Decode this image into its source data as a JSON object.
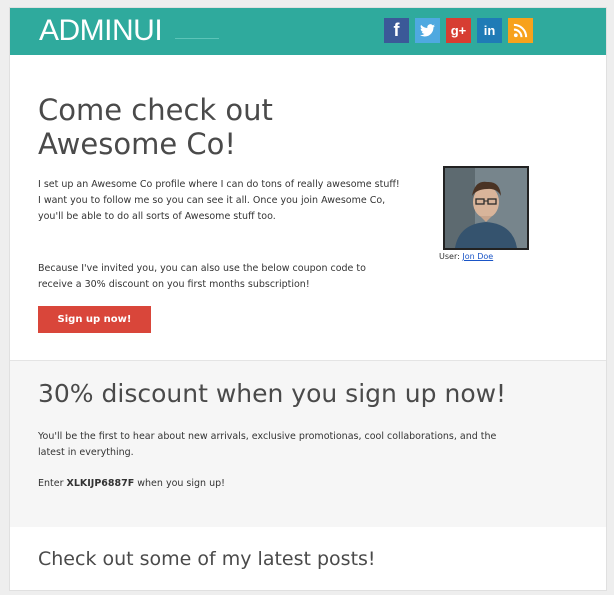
{
  "header": {
    "logo": "ADMINUI",
    "social": [
      {
        "name": "facebook-icon",
        "glyph": "f"
      },
      {
        "name": "twitter-icon",
        "glyph": "🐦"
      },
      {
        "name": "google-plus-icon",
        "glyph": "g+"
      },
      {
        "name": "linkedin-icon",
        "glyph": "in"
      },
      {
        "name": "rss-icon",
        "glyph": "◝"
      }
    ]
  },
  "invite": {
    "title": "Come check out Awesome Co!",
    "paragraph1": "I set up an Awesome Co profile where I can do tons of really awesome stuff! I want you to follow me so you can see it all. Once you join Awesome Co, you'll be able to do all sorts of Awesome stuff too.",
    "paragraph2": "Because I've invited you, you can also use the below coupon code to receive a 30% discount on you first months subscription!",
    "cta_label": "Sign up now!",
    "user_label": "User:",
    "user_name": "Jon Doe"
  },
  "discount": {
    "title": "30% discount when you sign up now!",
    "paragraph": "You'll be the first to hear about new arrivals, exclusive promotionas, cool collaborations, and the latest in everything.",
    "enter_prefix": "Enter",
    "code": "XLKIJP6887F",
    "enter_suffix": "when you sign up!"
  },
  "posts": {
    "title": "Check out some of my latest posts!"
  }
}
